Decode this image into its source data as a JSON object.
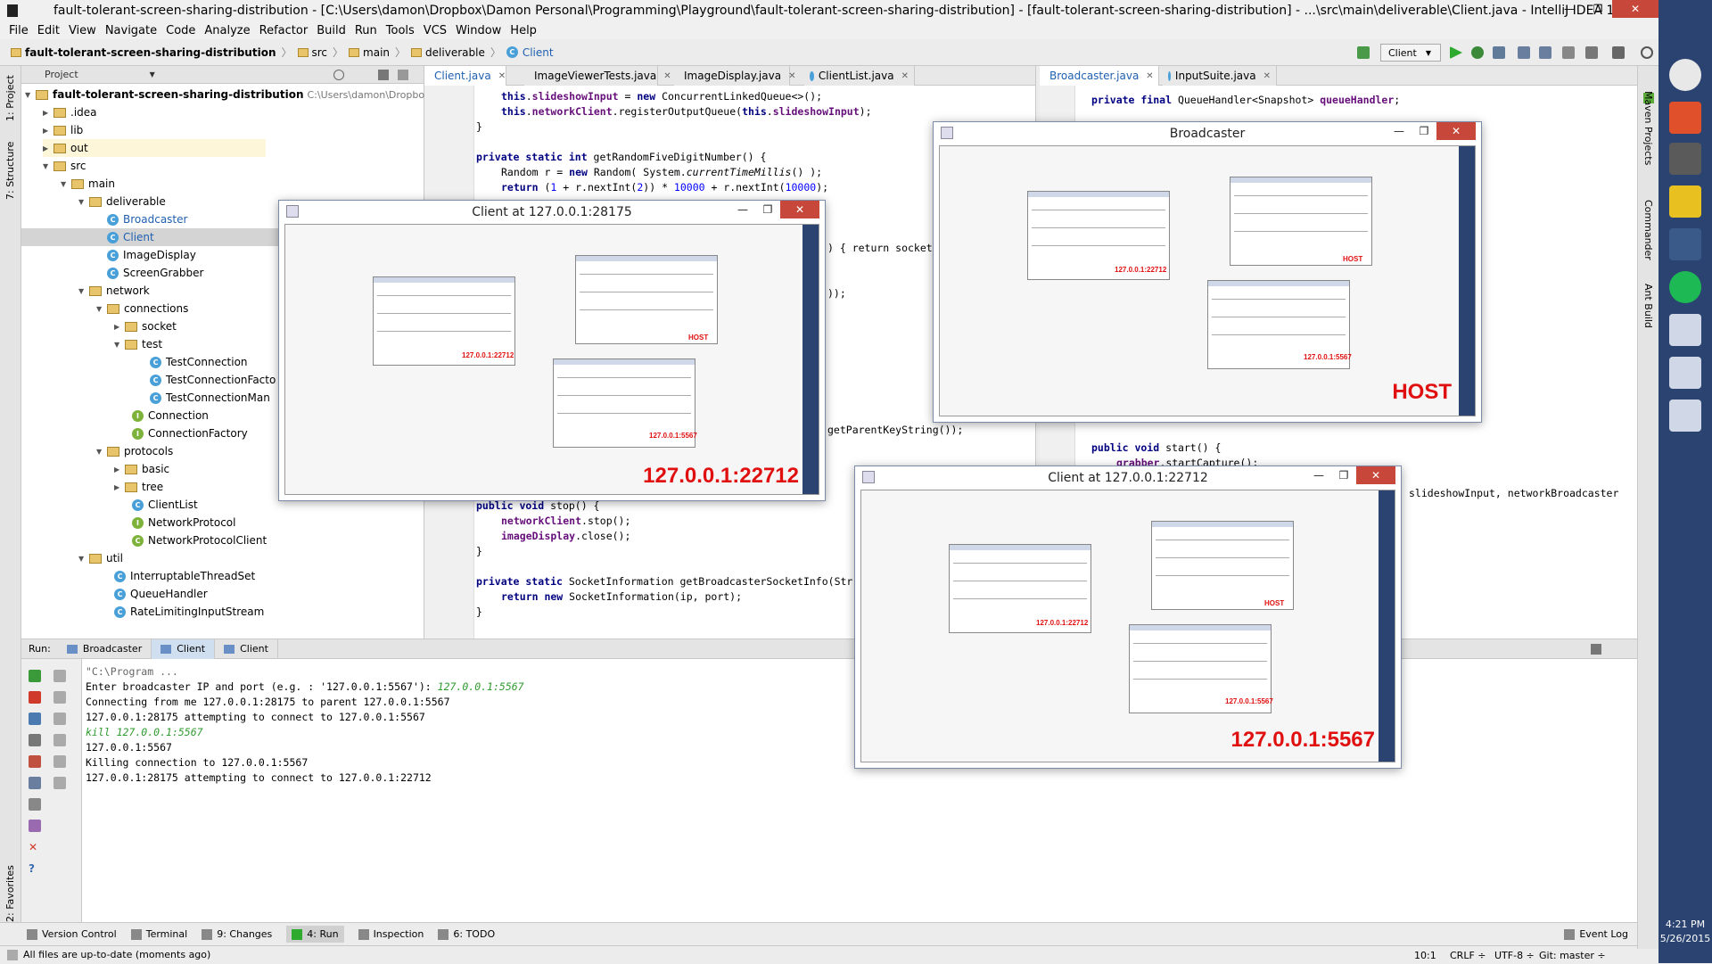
{
  "window": {
    "title": "fault-tolerant-screen-sharing-distribution - [C:\\Users\\damon\\Dropbox\\Damon Personal\\Programming\\Playground\\fault-tolerant-screen-sharing-distribution] - [fault-tolerant-screen-sharing-distribution] - ...\\src\\main\\deliverable\\Client.java - IntelliJ IDEA 14",
    "minimize": "—",
    "maximize": "❐",
    "close": "✕"
  },
  "menu": [
    "File",
    "Edit",
    "View",
    "Navigate",
    "Code",
    "Analyze",
    "Refactor",
    "Build",
    "Run",
    "Tools",
    "VCS",
    "Window",
    "Help"
  ],
  "breadcrumbs": [
    "fault-tolerant-screen-sharing-distribution",
    "src",
    "main",
    "deliverable",
    "Client"
  ],
  "toolbar": {
    "run_config": "Client"
  },
  "left_tools": {
    "project": "1: Project",
    "structure": "7: Structure",
    "favorites": "2: Favorites"
  },
  "right_tools": {
    "maven": "Maven Projects",
    "commander": "Commander",
    "ant": "Ant Build"
  },
  "project_panel": {
    "header": "Project",
    "root": "fault-tolerant-screen-sharing-distribution",
    "root_path": "C:\\Users\\damon\\Dropbox\\Da",
    "nodes": [
      ".idea",
      "lib",
      "out",
      "src",
      "main",
      "deliverable",
      "Broadcaster",
      "Client",
      "ImageDisplay",
      "ScreenGrabber",
      "network",
      "connections",
      "socket",
      "test",
      "TestConnection",
      "TestConnectionFacto",
      "TestConnectionMan",
      "Connection",
      "ConnectionFactory",
      "protocols",
      "basic",
      "tree",
      "ClientList",
      "NetworkProtocol",
      "NetworkProtocolClient",
      "util",
      "InterruptableThreadSet",
      "QueueHandler",
      "RateLimitingInputStream"
    ]
  },
  "editor_tabs": [
    "Client.java",
    "ImageViewerTests.java",
    "ImageDisplay.java",
    "ClientList.java"
  ],
  "editor2_tabs": [
    "Broadcaster.java",
    "InputSuite.java"
  ],
  "code": {
    "l1": "this.slideshowInput = new ConcurrentLinkedQueue<>();",
    "l2": "this.networkClient.registerOutputQueue(this.slideshowInput);",
    "l3": "}",
    "l4": "private static int getRandomFiveDigitNumber() {",
    "l5": "Random r = new Random( System.currentTimeMillis() );",
    "l6": "return (1 + r.nextInt(2)) * 10000 + r.nextInt(10000);",
    "frag1": ") { return socket",
    "frag2": "));",
    "frag3": "getParentKeyString());",
    "l10": "public void stop() {",
    "l11": "networkClient.stop();",
    "l12": "imageDisplay.close();",
    "l13": "}",
    "l14": "private static SocketInformation getBroadcasterSocketInfo(Str",
    "l15": "return new SocketInformation(ip, port);",
    "l16": "}"
  },
  "code2": {
    "l1": "private final QueueHandler<Snapshot> queueHandler;",
    "l2": "public void start() {",
    "l3": "grabber.startCapture();",
    "frag1": "t,",
    "frag2": "slideshowInput, networkBroadcaster"
  },
  "run_panel": {
    "label": "Run:",
    "tabs": [
      "Broadcaster",
      "Client",
      "Client"
    ],
    "console": [
      "\"C:\\Program ...",
      "Enter broadcaster IP and port (e.g. : '127.0.0.1:5567'): ",
      "Connecting from me 127.0.0.1:28175 to parent 127.0.0.1:5567",
      "",
      "127.0.0.1:28175 attempting to connect to 127.0.0.1:5567",
      "kill 127.0.0.1:5567",
      "127.0.0.1:5567",
      "Killing connection to 127.0.0.1:5567",
      "127.0.0.1:28175 attempting to connect to 127.0.0.1:22712"
    ],
    "input1": "127.0.0.1:5567"
  },
  "bottom_tools": [
    "Version Control",
    "Terminal",
    "9: Changes",
    "4: Run",
    "Inspection",
    "6: TODO"
  ],
  "event_log": "Event Log",
  "status": {
    "message": "All files are up-to-date (moments ago)",
    "position": "10:1",
    "line_sep": "CRLF ÷",
    "encoding": "UTF-8 ÷",
    "vcs": "Git: master ÷"
  },
  "clock": {
    "time": "4:21 PM",
    "date": "5/26/2015"
  },
  "windows": {
    "client1": {
      "title": "Client at 127.0.0.1:28175",
      "label": "127.0.0.1:22712"
    },
    "broadcaster": {
      "title": "Broadcaster",
      "label": "HOST"
    },
    "client2": {
      "title": "Client at 127.0.0.1:22712",
      "label": "127.0.0.1:5567"
    },
    "mini_labels": [
      "127.0.0.1:22712",
      "HOST",
      "127.0.0.1:5567"
    ]
  },
  "colors": {
    "taskbar": "#2b4370",
    "close": "#c7483a",
    "label": "#e01010",
    "keyword": "#000080"
  }
}
